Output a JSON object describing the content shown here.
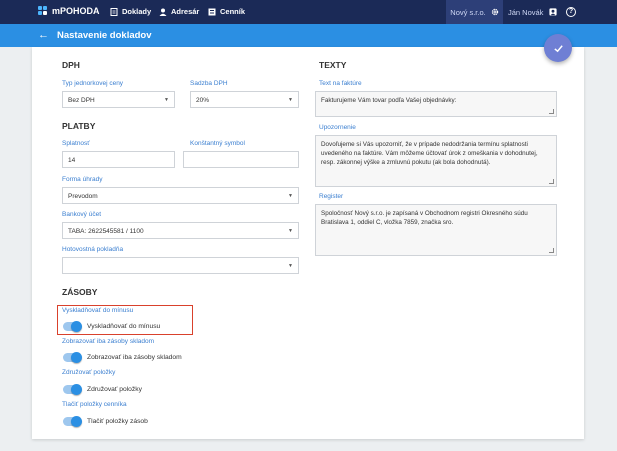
{
  "topbar": {
    "app_name": "mPOHODA",
    "nav": [
      {
        "label": "Doklady"
      },
      {
        "label": "Adresár"
      },
      {
        "label": "Cenník"
      }
    ],
    "company": "Nový s.r.o.",
    "user": "Ján Novák"
  },
  "titlebar": {
    "title": "Nastavenie dokladov"
  },
  "dph": {
    "heading": "DPH",
    "type_label": "Typ jednorkovej ceny",
    "type_value": "Bez DPH",
    "rate_label": "Sadzba DPH",
    "rate_value": "20%"
  },
  "platby": {
    "heading": "PLATBY",
    "due_label": "Splatnosť",
    "due_value": "14",
    "symbol_label": "Konštantný symbol",
    "symbol_value": "",
    "method_label": "Forma úhrady",
    "method_value": "Prevodom",
    "account_label": "Bankový účet",
    "account_value": "TABA: 2622545581 / 1100",
    "cash_label": "Hotovostná pokladňa",
    "cash_value": ""
  },
  "texty": {
    "heading": "TEXTY",
    "invoice_label": "Text na faktúre",
    "invoice_value": "Fakturujeme Vám tovar podľa Vašej objednávky:",
    "warning_label": "Upozornenie",
    "warning_value": "Dovoľujeme si Vás upozorniť, že v prípade nedodržania termínu splatnosti uvedeného na faktúre. Vám môžeme účtovať úrok z omeškania v dohodnutej, resp. zákonnej výške a zmluvnú pokutu (ak bola dohodnutá).",
    "register_label": "Register",
    "register_value": "Spoločnosť Nový s.r.o. je zapísaná v Obchodnom registri Okresného súdu Bratislava 1, oddiel C, vložka 7859, značka sro."
  },
  "zasoby": {
    "heading": "ZÁSOBY",
    "items": [
      {
        "label": "Vyskladňovať do mínusu",
        "toggle_text": "Vyskladňovať do mínusu",
        "on": true
      },
      {
        "label": "Zobrazovať iba zásoby skladom",
        "toggle_text": "Zobrazovať iba zásoby skladom",
        "on": true
      },
      {
        "label": "Združovať položky",
        "toggle_text": "Združovať položky",
        "on": true
      },
      {
        "label": "Tlačiť položky cenníka",
        "toggle_text": "Tlačiť položky zásob",
        "on": true
      }
    ]
  },
  "colors": {
    "topbar": "#1b2a57",
    "titlebar": "#2b8fe3",
    "accent": "#3b7fd0",
    "highlight": "#d9412c",
    "fab": "#6f7fd4"
  }
}
